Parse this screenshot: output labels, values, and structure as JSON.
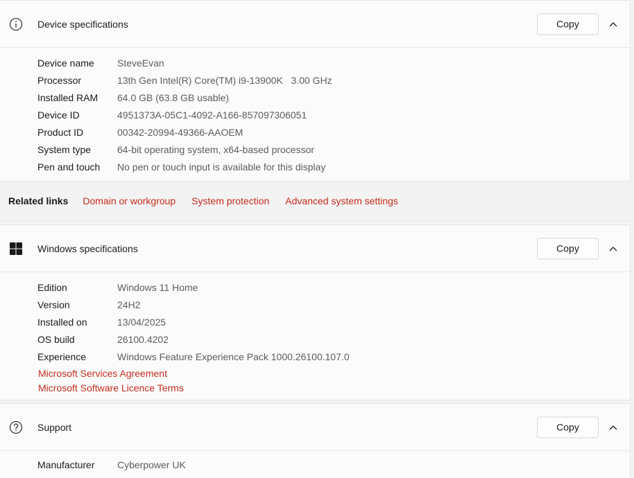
{
  "device": {
    "title": "Device specifications",
    "copy_label": "Copy",
    "rows": [
      {
        "label": "Device name",
        "value": "SteveEvan"
      },
      {
        "label": "Processor",
        "value": "13th Gen Intel(R) Core(TM) i9-13900K   3.00 GHz"
      },
      {
        "label": "Installed RAM",
        "value": "64.0 GB (63.8 GB usable)"
      },
      {
        "label": "Device ID",
        "value": "4951373A-05C1-4092-A166-857097306051"
      },
      {
        "label": "Product ID",
        "value": "00342-20994-49366-AAOEM"
      },
      {
        "label": "System type",
        "value": "64-bit operating system, x64-based processor"
      },
      {
        "label": "Pen and touch",
        "value": "No pen or touch input is available for this display"
      }
    ]
  },
  "related": {
    "title": "Related links",
    "links": [
      "Domain or workgroup",
      "System protection",
      "Advanced system settings"
    ]
  },
  "windows": {
    "title": "Windows specifications",
    "copy_label": "Copy",
    "rows": [
      {
        "label": "Edition",
        "value": "Windows 11 Home"
      },
      {
        "label": "Version",
        "value": "24H2"
      },
      {
        "label": "Installed on",
        "value": "13/04/2025"
      },
      {
        "label": "OS build",
        "value": "26100.4202"
      },
      {
        "label": "Experience",
        "value": "Windows Feature Experience Pack 1000.26100.107.0"
      }
    ],
    "links": [
      "Microsoft Services Agreement",
      "Microsoft Software Licence Terms"
    ]
  },
  "support": {
    "title": "Support",
    "copy_label": "Copy",
    "rows": [
      {
        "label": "Manufacturer",
        "value": "Cyberpower UK"
      }
    ]
  },
  "colors": {
    "link": "#c42b1c",
    "card": "#fbfbfb",
    "background": "#f3f3f3"
  },
  "icons": {
    "device": "info-icon",
    "windows": "windows-logo-icon",
    "support": "help-icon",
    "collapse": "chevron-up-icon"
  }
}
